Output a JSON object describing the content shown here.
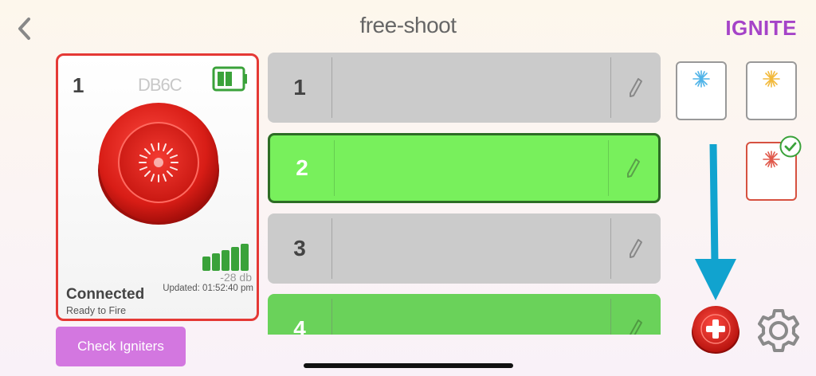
{
  "header": {
    "title": "free-shoot",
    "brand": "IGNITE"
  },
  "igniter_card": {
    "number": "1",
    "device_id": "DB6C",
    "signal_db": "-28 db",
    "updated": "Updated: 01:52:40 pm",
    "status": "Connected",
    "substatus": "Ready to Fire"
  },
  "check_igniters_label": "Check Igniters",
  "cues": [
    {
      "number": "1",
      "state": "grey"
    },
    {
      "number": "2",
      "state": "selected"
    },
    {
      "number": "3",
      "state": "grey"
    },
    {
      "number": "4",
      "state": "green"
    }
  ],
  "colors": {
    "accent_purple": "#a543c8",
    "button_purple": "#d377e0",
    "igniter_red": "#e53935",
    "cue_green": "#6ad25a",
    "cue_selected": "#78f05c",
    "arrow_blue": "#11a3cf"
  },
  "icons": {
    "back": "chevron-left-icon",
    "battery": "battery-icon",
    "signal": "signal-bars-icon",
    "edit": "pencil-icon",
    "add": "plus-circle-icon",
    "settings": "gear-icon",
    "check": "checkmark-icon"
  }
}
